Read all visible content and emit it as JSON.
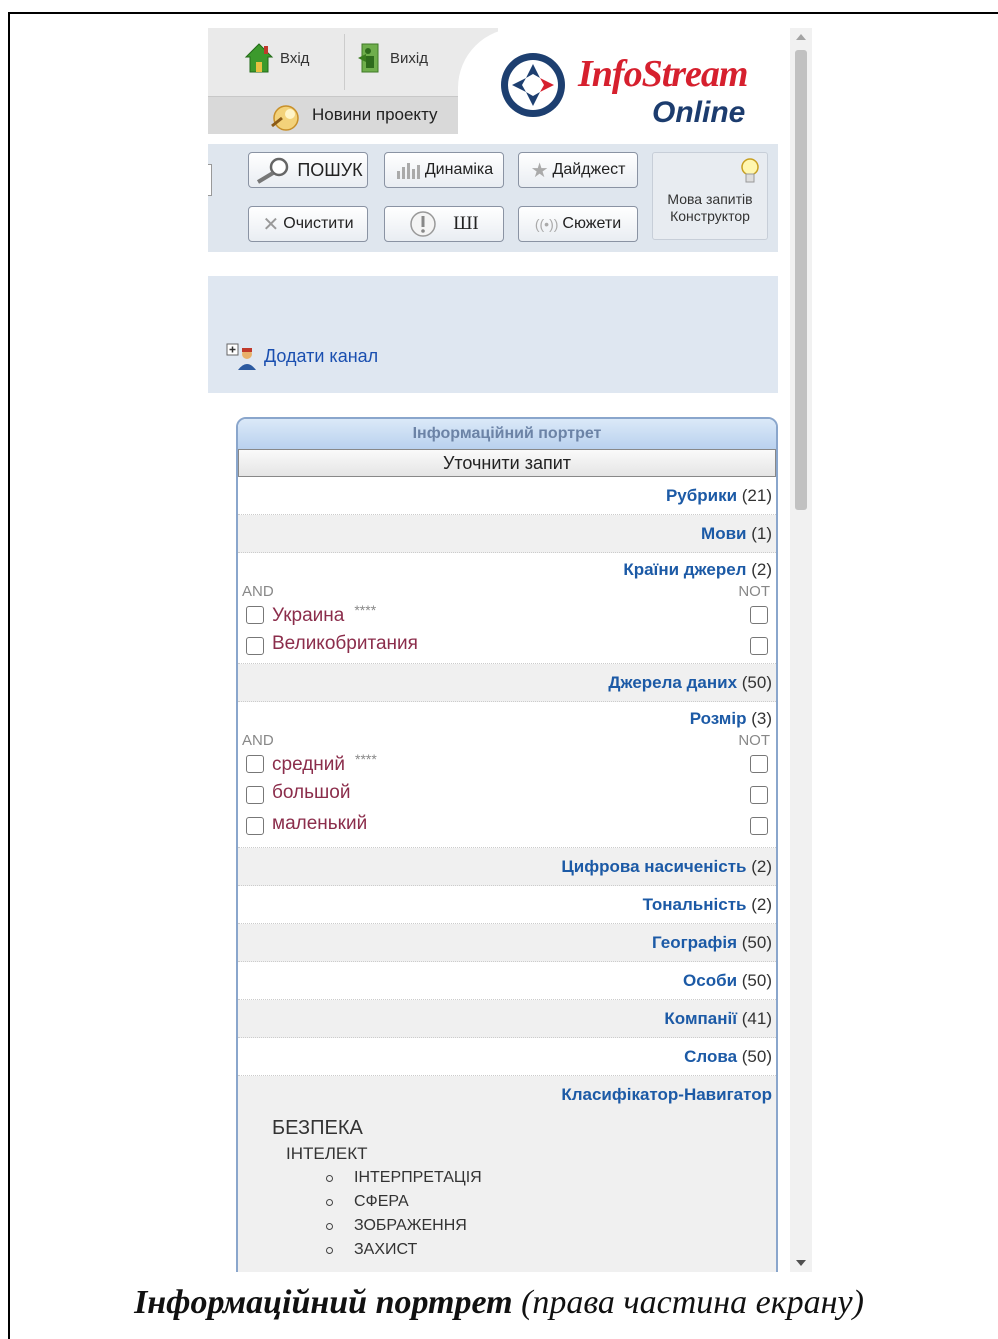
{
  "header": {
    "login_label": "Вхід",
    "logout_label": "Вихід",
    "news_label": "Новини проекту",
    "logo": {
      "line1": "InfoStream",
      "line2": "Online"
    }
  },
  "toolbar": {
    "search": "ПОШУК",
    "dynamics": "Динаміка",
    "digest": "Дайджест",
    "clear": "Очистити",
    "ai": "ШІ",
    "stories": "Сюжети",
    "lang_line1": "Мова запитів",
    "lang_line2": "Конструктор"
  },
  "channel": {
    "add_label": "Додати канал"
  },
  "portrait": {
    "title": "Інформаційний портрет",
    "refine_button": "Уточнити запит",
    "and_label": "AND",
    "not_label": "NOT",
    "stars": "****",
    "rubrics": {
      "label": "Рубрики",
      "count": "(21)"
    },
    "languages": {
      "label": "Мови",
      "count": "(1)"
    },
    "countries": {
      "label": "Країни джерел",
      "count": "(2)",
      "items": [
        "Украина",
        "Великобритания"
      ]
    },
    "sources": {
      "label": "Джерела даних",
      "count": "(50)"
    },
    "size": {
      "label": "Розмір",
      "count": "(3)",
      "items": [
        "средний",
        "большой",
        "маленький"
      ]
    },
    "digital": {
      "label": "Цифрова насиченість",
      "count": "(2)"
    },
    "tonality": {
      "label": "Тональність",
      "count": "(2)"
    },
    "geography": {
      "label": "Географія",
      "count": "(50)"
    },
    "persons": {
      "label": "Особи",
      "count": "(50)"
    },
    "companies": {
      "label": "Компанії",
      "count": "(41)"
    },
    "words": {
      "label": "Слова",
      "count": "(50)"
    },
    "classifier": {
      "label": "Класифікатор-Навигатор",
      "level1": "БЕЗПЕКА",
      "level2": "ІНТЕЛЕКТ",
      "level3": [
        "ІНТЕРПРЕТАЦІЯ",
        "СФЕРА",
        "ЗОБРАЖЕННЯ",
        "ЗАХИСТ"
      ]
    }
  },
  "caption": {
    "bold": "Інформаційний портрет",
    "rest": " (права частина екрану)"
  },
  "colors": {
    "category_blue": "#1c5aa6",
    "item_maroon": "#8b2d4b",
    "logo_red": "#d6202e",
    "logo_navy": "#1c3c6e"
  }
}
